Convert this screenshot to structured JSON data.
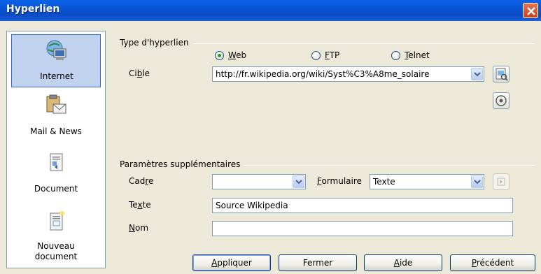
{
  "window": {
    "title": "Hyperlien"
  },
  "sidebar": {
    "items": [
      {
        "label": "Internet",
        "icon": "internet-globe-computer-icon",
        "selected": true
      },
      {
        "label": "Mail & News",
        "icon": "mail-news-icon",
        "selected": false
      },
      {
        "label": "Document",
        "icon": "document-icon",
        "selected": false
      },
      {
        "label": "Nouveau document",
        "label_line1": "Nouveau",
        "label_line2": "document",
        "icon": "new-document-icon",
        "selected": false
      }
    ]
  },
  "hyperlink_type": {
    "group_label": "Type d'hyperlien",
    "options": [
      {
        "pre": "",
        "accel": "W",
        "post": "eb",
        "selected": true
      },
      {
        "pre": "",
        "accel": "F",
        "post": "TP",
        "selected": false
      },
      {
        "pre": "",
        "accel": "T",
        "post": "elnet",
        "selected": false
      }
    ],
    "target": {
      "label_pre": "Ci",
      "label_accel": "b",
      "label_post": "le",
      "value": "http://fr.wikipedia.org/wiki/Syst%C3%A8me_solaire"
    }
  },
  "extra": {
    "group_label": "Paramètres supplémentaires",
    "frame": {
      "label_pre": "Cad",
      "label_accel": "r",
      "label_post": "e",
      "value": ""
    },
    "form": {
      "label_pre": "",
      "label_accel": "F",
      "label_post": "ormulaire",
      "value": "Texte"
    },
    "text": {
      "label_pre": "Te",
      "label_accel": "x",
      "label_post": "te",
      "value": "Source Wikipedia"
    },
    "name": {
      "label_pre": "",
      "label_accel": "N",
      "label_post": "om",
      "value": ""
    }
  },
  "buttons": {
    "apply": {
      "pre": "",
      "accel": "A",
      "post": "ppliquer"
    },
    "close": {
      "label": "Fermer"
    },
    "help": {
      "pre": "",
      "accel": "A",
      "post": "ide"
    },
    "previous": {
      "pre": "",
      "accel": "P",
      "post": "récédent"
    }
  },
  "colors": {
    "titlebar": "#0a5fe0",
    "selection": "#c1d2ee",
    "radio_checked": "#21a121"
  }
}
